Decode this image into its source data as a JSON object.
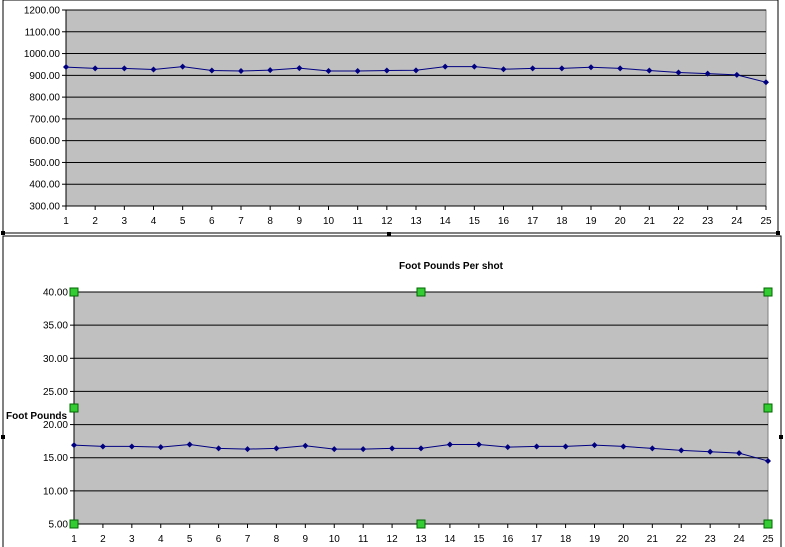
{
  "chart_data": [
    {
      "type": "line",
      "title": "",
      "xlabel": "",
      "ylabel": "",
      "ylim": [
        300,
        1200
      ],
      "yticks": [
        "300.00",
        "400.00",
        "500.00",
        "600.00",
        "700.00",
        "800.00",
        "900.00",
        "1000.00",
        "1100.00",
        "1200.00"
      ],
      "x": [
        1,
        2,
        3,
        4,
        5,
        6,
        7,
        8,
        9,
        10,
        11,
        12,
        13,
        14,
        15,
        16,
        17,
        18,
        19,
        20,
        21,
        22,
        23,
        24,
        25
      ],
      "series": [
        {
          "values": [
            938,
            932,
            932,
            927,
            940,
            922,
            920,
            924,
            933,
            920,
            920,
            922,
            923,
            940,
            940,
            928,
            932,
            932,
            937,
            932,
            922,
            913,
            908,
            902,
            868
          ],
          "color": "#000080"
        }
      ],
      "plot_bg": "#c0c0c0",
      "grid": true,
      "legend": "none"
    },
    {
      "type": "line",
      "title": "Foot Pounds Per shot",
      "xlabel": "",
      "ylabel": "Foot Pounds",
      "ylim": [
        5,
        40
      ],
      "yticks": [
        "5.00",
        "10.00",
        "15.00",
        "20.00",
        "25.00",
        "30.00",
        "35.00",
        "40.00"
      ],
      "x": [
        1,
        2,
        3,
        4,
        5,
        6,
        7,
        8,
        9,
        10,
        11,
        12,
        13,
        14,
        15,
        16,
        17,
        18,
        19,
        20,
        21,
        22,
        23,
        24,
        25
      ],
      "series": [
        {
          "values": [
            16.9,
            16.7,
            16.7,
            16.6,
            17.0,
            16.4,
            16.3,
            16.4,
            16.8,
            16.3,
            16.3,
            16.4,
            16.4,
            17.0,
            17.0,
            16.6,
            16.7,
            16.7,
            16.9,
            16.7,
            16.4,
            16.1,
            15.9,
            15.7,
            14.5
          ],
          "color": "#000080"
        }
      ],
      "plot_bg": "#c0c0c0",
      "grid": true,
      "legend": "none",
      "selected": true
    }
  ]
}
